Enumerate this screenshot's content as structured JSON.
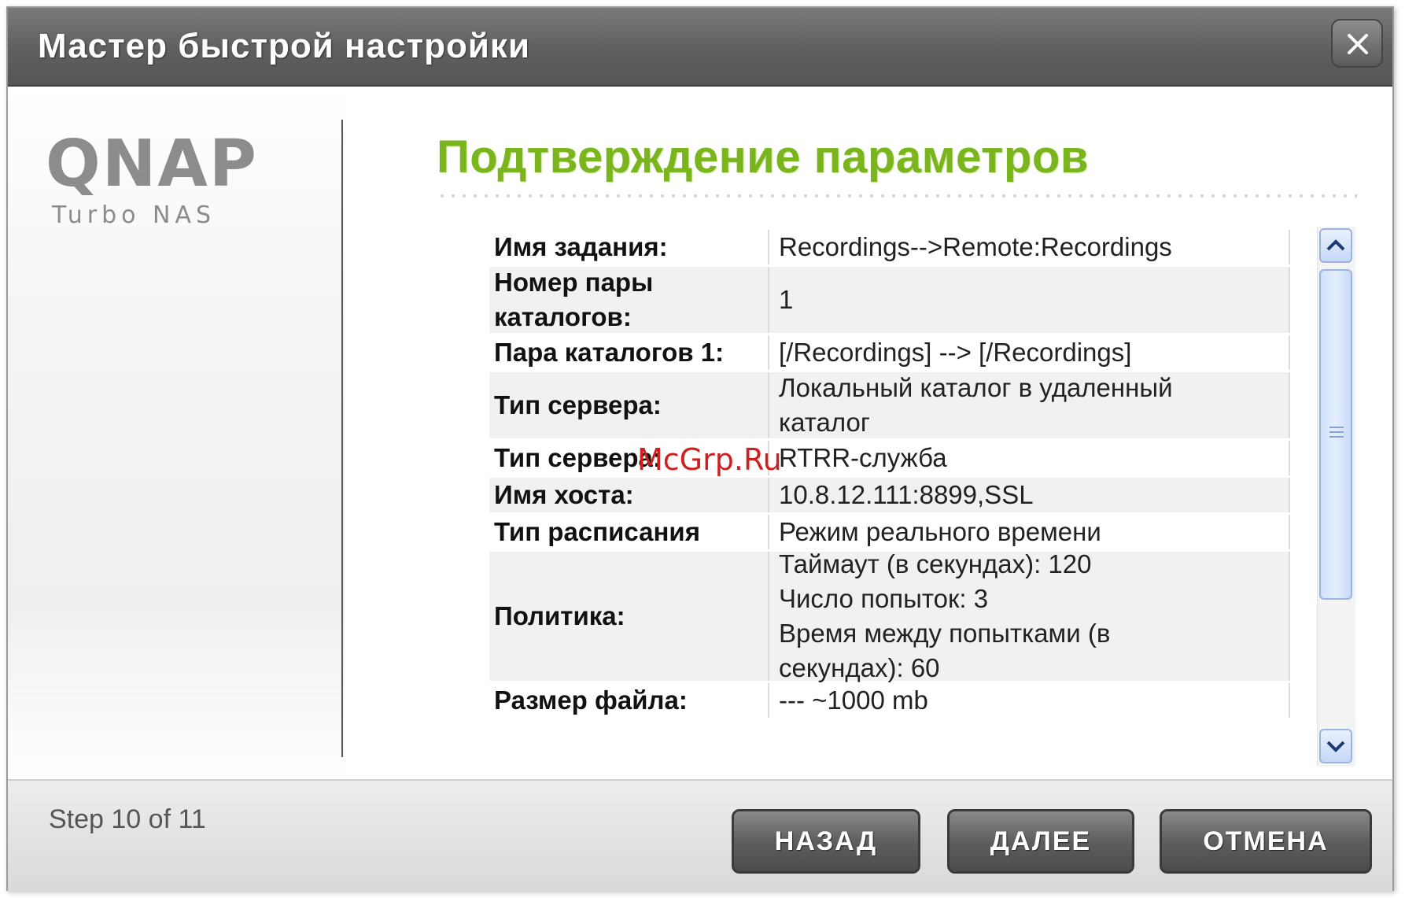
{
  "window": {
    "title": "Мастер быстрой настройки"
  },
  "brand": {
    "logo_main": "QNAP",
    "logo_sub": "Turbo NAS"
  },
  "main": {
    "heading": "Подтверждение параметров"
  },
  "summary": [
    {
      "label": "Имя задания:",
      "value": [
        "Recordings-->Remote:Recordings"
      ]
    },
    {
      "label": "Номер пары каталогов:",
      "value": [
        "1"
      ]
    },
    {
      "label": "Пара каталогов 1:",
      "value": [
        "[/Recordings] --> [/Recordings]"
      ]
    },
    {
      "label": "Тип сервера:",
      "value": [
        "Локальный каталог в удаленный",
        "каталог"
      ]
    },
    {
      "label": "Тип сервера:",
      "value": [
        "RTRR-служба"
      ]
    },
    {
      "label": "Имя хоста:",
      "value": [
        "10.8.12.111:8899,SSL"
      ]
    },
    {
      "label": "Тип расписания",
      "value": [
        "Режим реального времени"
      ]
    },
    {
      "label": "Политика:",
      "value": [
        "Таймаут (в секундах): 120",
        "Число попыток: 3",
        "Время между попытками (в",
        "секундах): 60"
      ]
    },
    {
      "label": "Размер файла:",
      "value": [
        "--- ~1000 mb"
      ]
    }
  ],
  "footer": {
    "step": "Step 10 of 11",
    "back_label": "НАЗАД",
    "next_label": "ДАЛЕЕ",
    "cancel_label": "ОТМЕНА"
  },
  "watermark": "McGrp.Ru",
  "icons": {
    "close": "close-icon",
    "scroll_up": "chevron-up-icon",
    "scroll_down": "chevron-down-icon"
  },
  "colors": {
    "heading": "#7ab51d",
    "titlebar": "#666666",
    "watermark": "#cf1f1f"
  }
}
